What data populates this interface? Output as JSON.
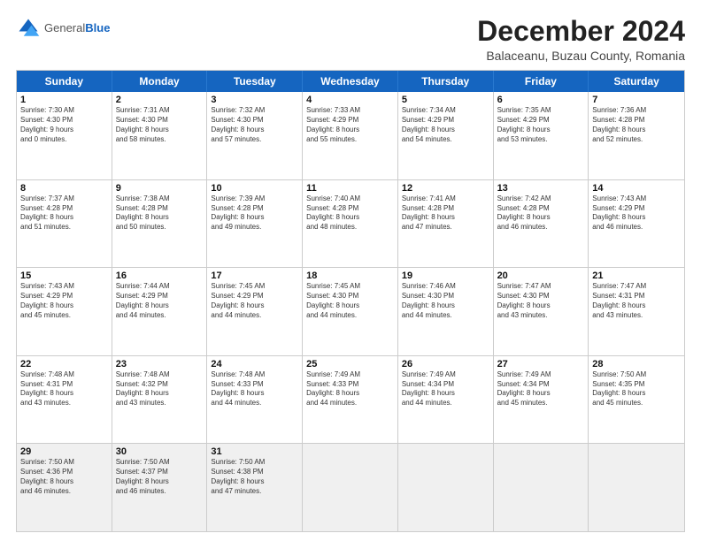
{
  "logo": {
    "general": "General",
    "blue": "Blue"
  },
  "title": "December 2024",
  "location": "Balaceanu, Buzau County, Romania",
  "days_header": [
    "Sunday",
    "Monday",
    "Tuesday",
    "Wednesday",
    "Thursday",
    "Friday",
    "Saturday"
  ],
  "weeks": [
    [
      {
        "day": "1",
        "lines": [
          "Sunrise: 7:30 AM",
          "Sunset: 4:30 PM",
          "Daylight: 9 hours",
          "and 0 minutes."
        ]
      },
      {
        "day": "2",
        "lines": [
          "Sunrise: 7:31 AM",
          "Sunset: 4:30 PM",
          "Daylight: 8 hours",
          "and 58 minutes."
        ]
      },
      {
        "day": "3",
        "lines": [
          "Sunrise: 7:32 AM",
          "Sunset: 4:30 PM",
          "Daylight: 8 hours",
          "and 57 minutes."
        ]
      },
      {
        "day": "4",
        "lines": [
          "Sunrise: 7:33 AM",
          "Sunset: 4:29 PM",
          "Daylight: 8 hours",
          "and 55 minutes."
        ]
      },
      {
        "day": "5",
        "lines": [
          "Sunrise: 7:34 AM",
          "Sunset: 4:29 PM",
          "Daylight: 8 hours",
          "and 54 minutes."
        ]
      },
      {
        "day": "6",
        "lines": [
          "Sunrise: 7:35 AM",
          "Sunset: 4:29 PM",
          "Daylight: 8 hours",
          "and 53 minutes."
        ]
      },
      {
        "day": "7",
        "lines": [
          "Sunrise: 7:36 AM",
          "Sunset: 4:28 PM",
          "Daylight: 8 hours",
          "and 52 minutes."
        ]
      }
    ],
    [
      {
        "day": "8",
        "lines": [
          "Sunrise: 7:37 AM",
          "Sunset: 4:28 PM",
          "Daylight: 8 hours",
          "and 51 minutes."
        ]
      },
      {
        "day": "9",
        "lines": [
          "Sunrise: 7:38 AM",
          "Sunset: 4:28 PM",
          "Daylight: 8 hours",
          "and 50 minutes."
        ]
      },
      {
        "day": "10",
        "lines": [
          "Sunrise: 7:39 AM",
          "Sunset: 4:28 PM",
          "Daylight: 8 hours",
          "and 49 minutes."
        ]
      },
      {
        "day": "11",
        "lines": [
          "Sunrise: 7:40 AM",
          "Sunset: 4:28 PM",
          "Daylight: 8 hours",
          "and 48 minutes."
        ]
      },
      {
        "day": "12",
        "lines": [
          "Sunrise: 7:41 AM",
          "Sunset: 4:28 PM",
          "Daylight: 8 hours",
          "and 47 minutes."
        ]
      },
      {
        "day": "13",
        "lines": [
          "Sunrise: 7:42 AM",
          "Sunset: 4:28 PM",
          "Daylight: 8 hours",
          "and 46 minutes."
        ]
      },
      {
        "day": "14",
        "lines": [
          "Sunrise: 7:43 AM",
          "Sunset: 4:29 PM",
          "Daylight: 8 hours",
          "and 46 minutes."
        ]
      }
    ],
    [
      {
        "day": "15",
        "lines": [
          "Sunrise: 7:43 AM",
          "Sunset: 4:29 PM",
          "Daylight: 8 hours",
          "and 45 minutes."
        ]
      },
      {
        "day": "16",
        "lines": [
          "Sunrise: 7:44 AM",
          "Sunset: 4:29 PM",
          "Daylight: 8 hours",
          "and 44 minutes."
        ]
      },
      {
        "day": "17",
        "lines": [
          "Sunrise: 7:45 AM",
          "Sunset: 4:29 PM",
          "Daylight: 8 hours",
          "and 44 minutes."
        ]
      },
      {
        "day": "18",
        "lines": [
          "Sunrise: 7:45 AM",
          "Sunset: 4:30 PM",
          "Daylight: 8 hours",
          "and 44 minutes."
        ]
      },
      {
        "day": "19",
        "lines": [
          "Sunrise: 7:46 AM",
          "Sunset: 4:30 PM",
          "Daylight: 8 hours",
          "and 44 minutes."
        ]
      },
      {
        "day": "20",
        "lines": [
          "Sunrise: 7:47 AM",
          "Sunset: 4:30 PM",
          "Daylight: 8 hours",
          "and 43 minutes."
        ]
      },
      {
        "day": "21",
        "lines": [
          "Sunrise: 7:47 AM",
          "Sunset: 4:31 PM",
          "Daylight: 8 hours",
          "and 43 minutes."
        ]
      }
    ],
    [
      {
        "day": "22",
        "lines": [
          "Sunrise: 7:48 AM",
          "Sunset: 4:31 PM",
          "Daylight: 8 hours",
          "and 43 minutes."
        ]
      },
      {
        "day": "23",
        "lines": [
          "Sunrise: 7:48 AM",
          "Sunset: 4:32 PM",
          "Daylight: 8 hours",
          "and 43 minutes."
        ]
      },
      {
        "day": "24",
        "lines": [
          "Sunrise: 7:48 AM",
          "Sunset: 4:33 PM",
          "Daylight: 8 hours",
          "and 44 minutes."
        ]
      },
      {
        "day": "25",
        "lines": [
          "Sunrise: 7:49 AM",
          "Sunset: 4:33 PM",
          "Daylight: 8 hours",
          "and 44 minutes."
        ]
      },
      {
        "day": "26",
        "lines": [
          "Sunrise: 7:49 AM",
          "Sunset: 4:34 PM",
          "Daylight: 8 hours",
          "and 44 minutes."
        ]
      },
      {
        "day": "27",
        "lines": [
          "Sunrise: 7:49 AM",
          "Sunset: 4:34 PM",
          "Daylight: 8 hours",
          "and 45 minutes."
        ]
      },
      {
        "day": "28",
        "lines": [
          "Sunrise: 7:50 AM",
          "Sunset: 4:35 PM",
          "Daylight: 8 hours",
          "and 45 minutes."
        ]
      }
    ],
    [
      {
        "day": "29",
        "lines": [
          "Sunrise: 7:50 AM",
          "Sunset: 4:36 PM",
          "Daylight: 8 hours",
          "and 46 minutes."
        ]
      },
      {
        "day": "30",
        "lines": [
          "Sunrise: 7:50 AM",
          "Sunset: 4:37 PM",
          "Daylight: 8 hours",
          "and 46 minutes."
        ]
      },
      {
        "day": "31",
        "lines": [
          "Sunrise: 7:50 AM",
          "Sunset: 4:38 PM",
          "Daylight: 8 hours",
          "and 47 minutes."
        ]
      },
      {
        "day": "",
        "lines": []
      },
      {
        "day": "",
        "lines": []
      },
      {
        "day": "",
        "lines": []
      },
      {
        "day": "",
        "lines": []
      }
    ]
  ]
}
